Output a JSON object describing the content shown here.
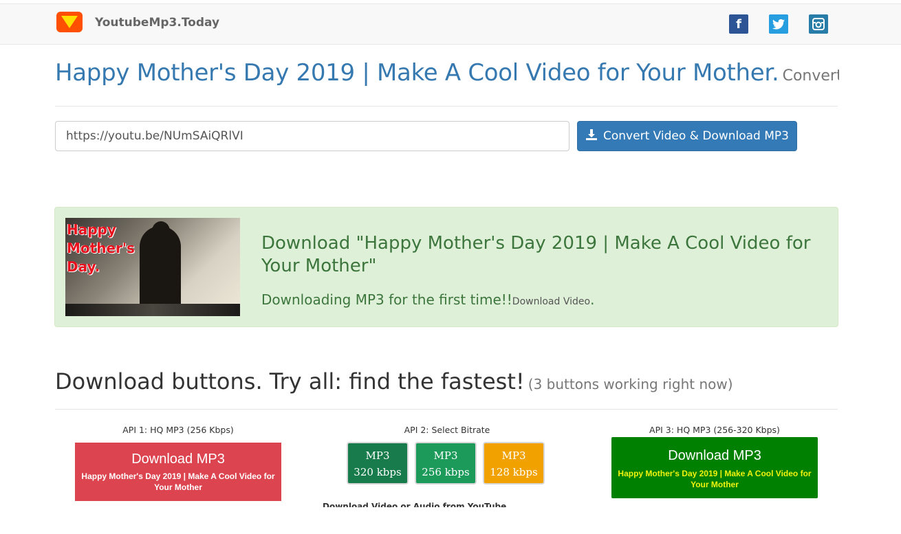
{
  "header": {
    "brand": "YoutubeMp3.Today",
    "logo_icon": "play-triangle-icon",
    "logo_color": "#ff4f00",
    "social": [
      {
        "name": "facebook",
        "glyph": "f",
        "color": "#2d5596"
      },
      {
        "name": "twitter",
        "glyph": "t",
        "color": "#279ee0"
      },
      {
        "name": "instagram",
        "glyph": "◘",
        "color": "#277ca8"
      }
    ]
  },
  "headline": {
    "title": "Happy Mother's Day 2019 | Make A Cool Video for Your Mother.",
    "subtitle": "Convert..."
  },
  "search": {
    "value": "https://youtu.be/NUmSAiQRlVI",
    "button_label": "Convert Video & Download MP3"
  },
  "result": {
    "thumb_text": [
      "Happy",
      "Mother's",
      "Day."
    ],
    "title": "Download \"Happy Mother's Day 2019 | Make A Cool Video for Your Mother\"",
    "subtitle": "Downloading MP3 for the first time!!",
    "link": "Download Video",
    "suffix": "."
  },
  "downloads": {
    "heading": "Download buttons. Try all: find the fastest!",
    "heading_note": "(3 buttons working right now)",
    "api1": {
      "label": "API 1: HQ MP3 (256 Kbps)",
      "button": "Download MP3",
      "sub": "Happy Mother's Day 2019 | Make A Cool Video for Your Mother",
      "color": "#dc4550"
    },
    "api2": {
      "label": "API 2: Select Bitrate",
      "options": [
        {
          "format": "MP3",
          "bitrate": "320 kbps",
          "color": "#177b4b"
        },
        {
          "format": "MP3",
          "bitrate": "256 kbps",
          "color": "#1b9a5a"
        },
        {
          "format": "MP3",
          "bitrate": "128 kbps",
          "color": "#f1a200"
        }
      ],
      "footer": "Download Video or Audio from YouTube"
    },
    "api3": {
      "label": "API 3: HQ MP3 (256-320 Kbps)",
      "button": "Download MP3",
      "sub": "Happy Mother's Day 2019 | Make A Cool Video for Your Mother",
      "color": "#008000"
    }
  }
}
